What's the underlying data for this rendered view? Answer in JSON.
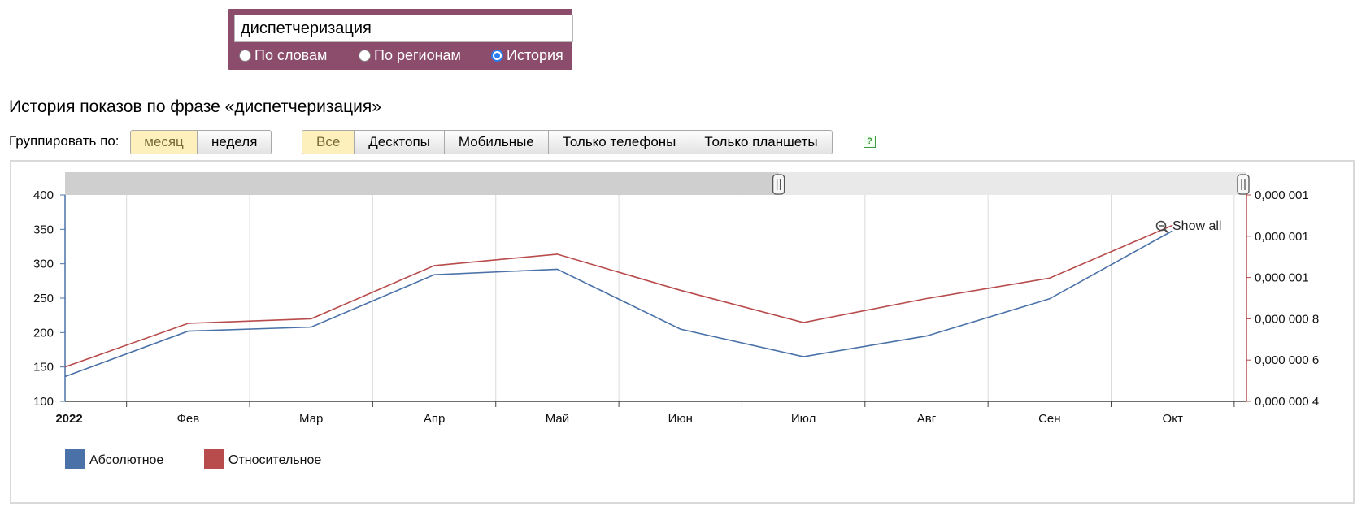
{
  "search": {
    "value": "диспетчеризация",
    "options": [
      {
        "label": "По словам",
        "checked": false
      },
      {
        "label": "По регионам",
        "checked": false
      },
      {
        "label": "История",
        "checked": true
      }
    ]
  },
  "page_title": "История показов по фразе «диспетчеризация»",
  "toolbar": {
    "group_label": "Группировать по:",
    "group_buttons": [
      {
        "label": "месяц",
        "active": true
      },
      {
        "label": "неделя",
        "active": false
      }
    ],
    "device_buttons": [
      {
        "label": "Все",
        "active": true
      },
      {
        "label": "Десктопы",
        "active": false
      },
      {
        "label": "Мобильные",
        "active": false
      },
      {
        "label": "Только телефоны",
        "active": false
      },
      {
        "label": "Только планшеты",
        "active": false
      }
    ],
    "help_icon": "question-icon"
  },
  "chart_controls": {
    "show_all_label": "Show all",
    "show_all_icon": "zoom-out-icon"
  },
  "chart_data": {
    "type": "line",
    "categories": [
      "2022",
      "Фев",
      "Мар",
      "Апр",
      "Май",
      "Июн",
      "Июл",
      "Авг",
      "Сен",
      "Окт"
    ],
    "left_axis": {
      "ylim": [
        100,
        400
      ],
      "ticks": [
        "400",
        "350",
        "300",
        "250",
        "200",
        "150",
        "100"
      ]
    },
    "right_axis": {
      "ylim": [
        4e-07,
        1.4e-06
      ],
      "ticks": [
        "0,000 001",
        "0,000 001",
        "0,000 001",
        "0,000 000 8",
        "0,000 000 6",
        "0,000 000 4"
      ]
    },
    "series": [
      {
        "name": "Абсолютное",
        "axis": "left",
        "color": "#4a72a8",
        "values": [
          136,
          202,
          208,
          284,
          292,
          205,
          165,
          195,
          249,
          348
        ]
      },
      {
        "name": "Относительное",
        "axis": "right",
        "color": "#b84b4b",
        "values": [
          5.67e-07,
          7.78e-07,
          8e-07,
          1.058e-06,
          1.113e-06,
          9.38e-07,
          7.82e-07,
          8.98e-07,
          9.97e-07,
          1.253e-06
        ]
      }
    ],
    "legend_position": "bottom-left",
    "grid": "vertical",
    "navigator_range": [
      0.604,
      1.0
    ]
  }
}
